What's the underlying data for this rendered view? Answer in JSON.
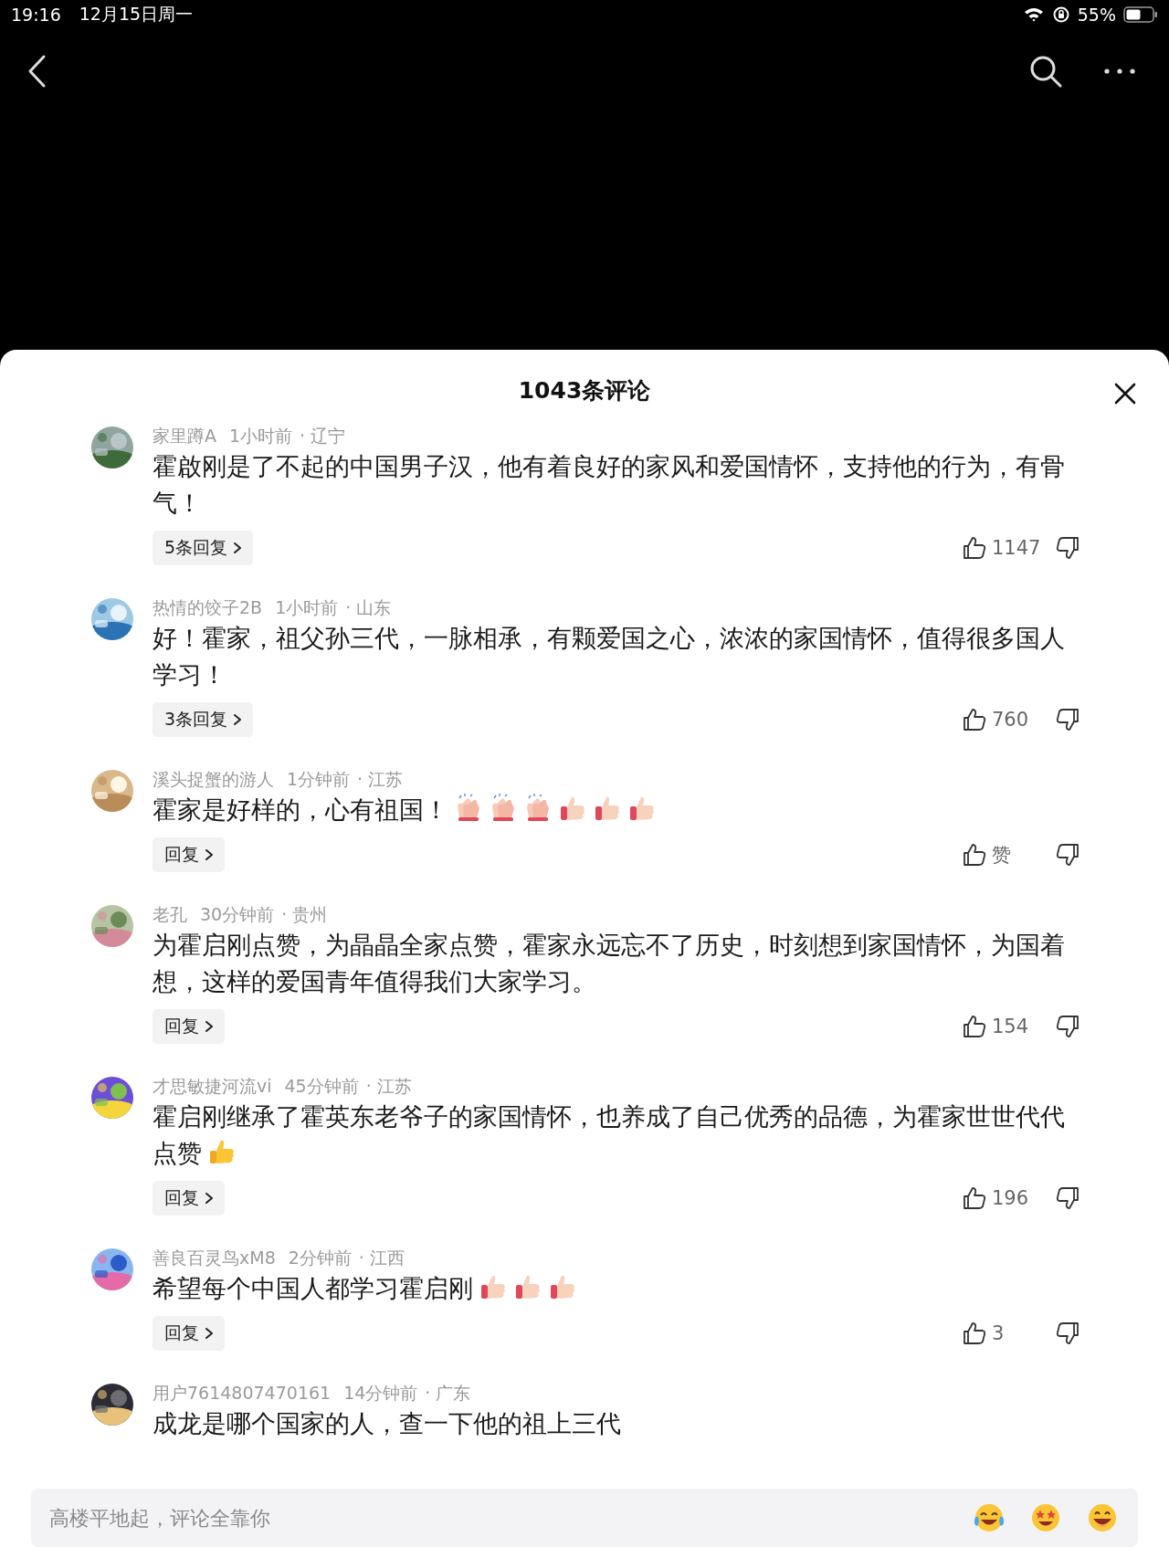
{
  "status_bar": {
    "time": "19:16",
    "date": "12月15日周一",
    "battery_text": "55%"
  },
  "comments_panel": {
    "title": "1043条评论",
    "comments": [
      {
        "user": "家里蹲A",
        "time": "1小时前",
        "location": "· 辽宁",
        "text": "霍啟刚是了不起的中国男子汉，他有着良好的家风和爱国情怀，支持他的行为，有骨气！",
        "reply_label": "5条回复",
        "likes": "1147"
      },
      {
        "user": "热情的饺子2B",
        "time": "1小时前",
        "location": "· 山东",
        "text": "好！霍家，祖父孙三代，一脉相承，有颗爱国之心，浓浓的家国情怀，值得很多国人学习！",
        "reply_label": "3条回复",
        "likes": "760"
      },
      {
        "user": "溪头捉蟹的游人",
        "time": "1分钟前",
        "location": "· 江苏",
        "text": "霍家是好样的，心有祖国！",
        "emojis": [
          {
            "kind": "clap"
          },
          {
            "kind": "clap"
          },
          {
            "kind": "clap"
          },
          {
            "kind": "thumb"
          },
          {
            "kind": "thumb"
          },
          {
            "kind": "thumb"
          }
        ],
        "reply_label": "回复",
        "likes": "赞"
      },
      {
        "user": "老孔",
        "time": "30分钟前",
        "location": "· 贵州",
        "text": "为霍启刚点赞，为晶晶全家点赞，霍家永远忘不了历史，时刻想到家国情怀，为国着想，这样的爱国青年值得我们大家学习。",
        "reply_label": "回复",
        "likes": "154"
      },
      {
        "user": "才思敏捷河流vi",
        "time": "45分钟前",
        "location": "· 江苏",
        "text": "霍启刚继承了霍英东老爷子的家国情怀，也养成了自己优秀的品德，为霍家世世代代点赞",
        "emojis": [
          {
            "kind": "thumb_yellow"
          }
        ],
        "reply_label": "回复",
        "likes": "196"
      },
      {
        "user": "善良百灵鸟xM8",
        "time": "2分钟前",
        "location": "· 江西",
        "text": "希望每个中国人都学习霍启刚",
        "emojis": [
          {
            "kind": "thumb"
          },
          {
            "kind": "thumb"
          },
          {
            "kind": "thumb"
          }
        ],
        "reply_label": "回复",
        "likes": "3"
      },
      {
        "user": "用户7614807470161",
        "time": "14分钟前",
        "location": "· 广东",
        "text": "成龙是哪个国家的人，查一下他的祖上三代"
      }
    ]
  },
  "comment_input": {
    "placeholder": "高楼平地起，评论全靠你"
  }
}
